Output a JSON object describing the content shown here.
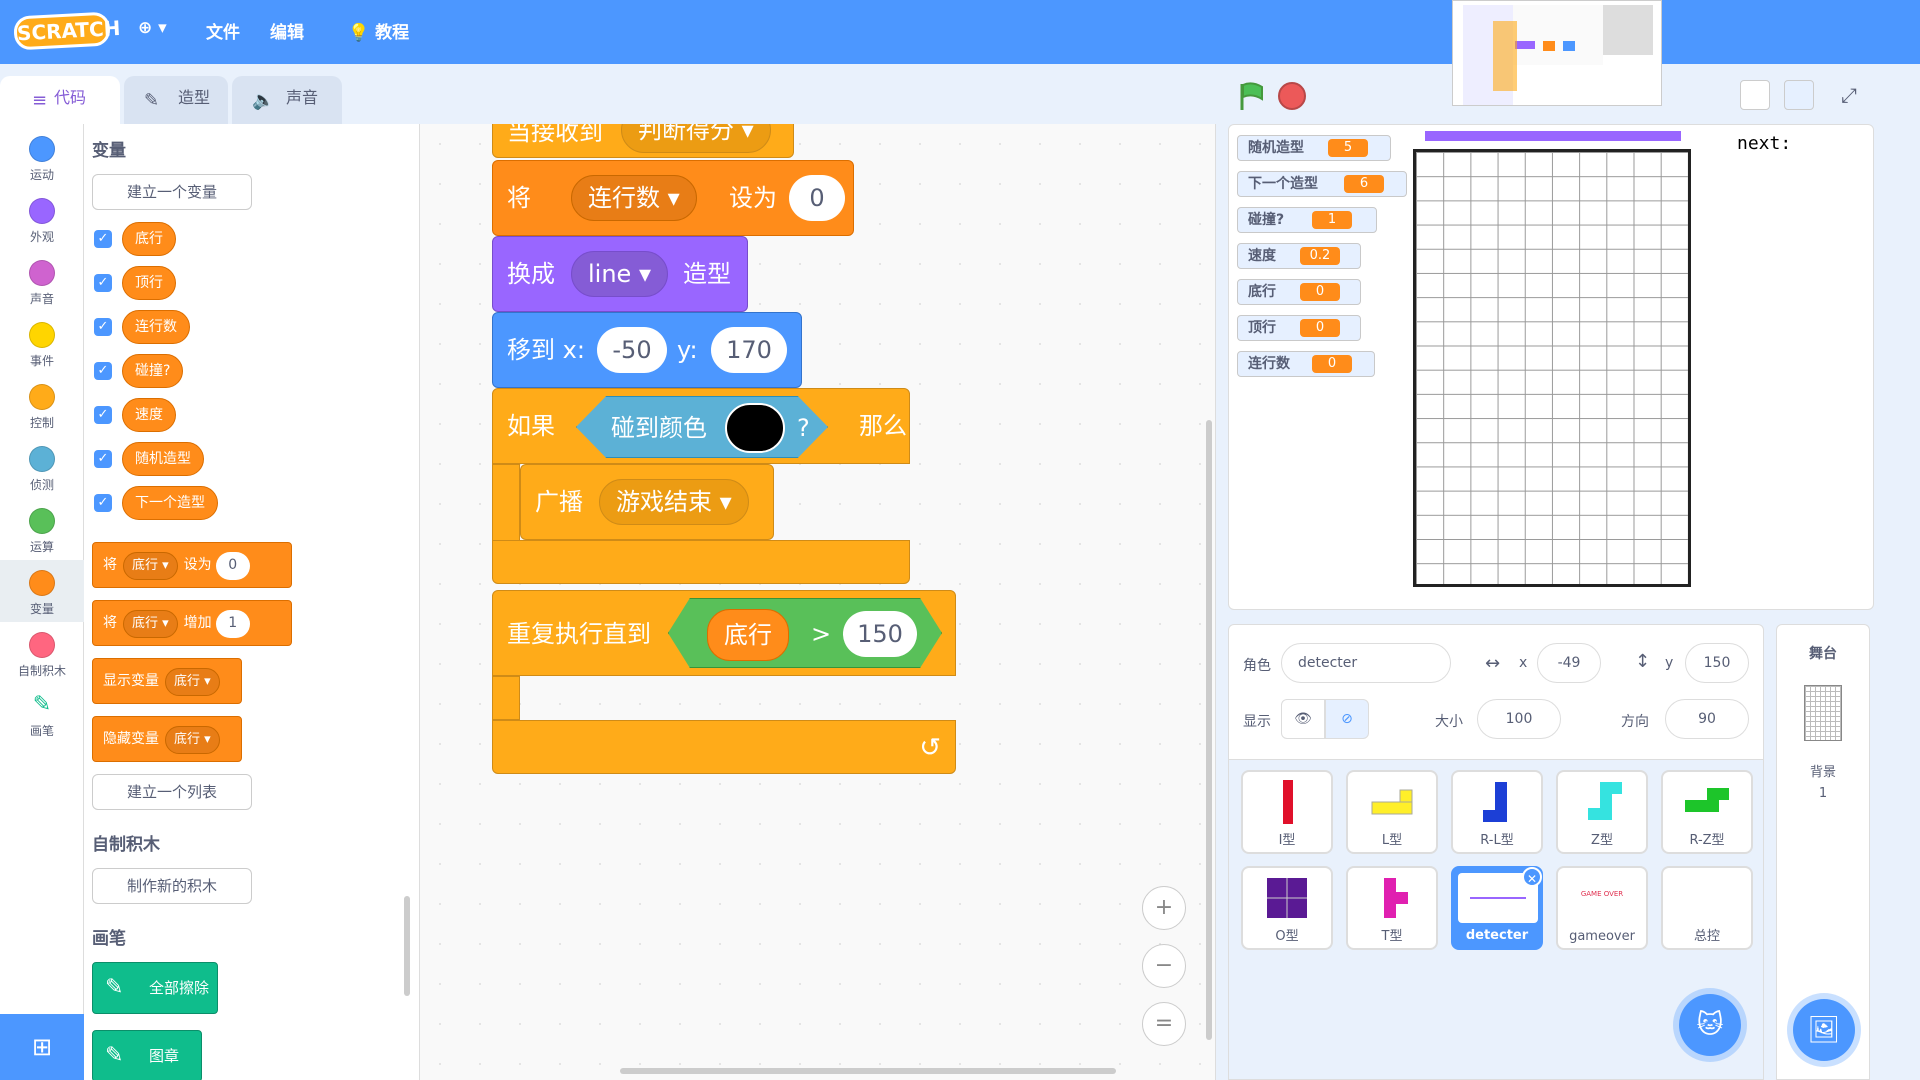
{
  "menubar": {
    "logo": "SCRATCH",
    "globe": "⊕ ▾",
    "file": "文件",
    "edit": "编辑",
    "tutorial": "教程"
  },
  "tabs": {
    "code": "代码",
    "costumes": "造型",
    "sounds": "声音"
  },
  "categories": [
    {
      "label": "运动",
      "color": "#4c97ff"
    },
    {
      "label": "外观",
      "color": "#9966ff"
    },
    {
      "label": "声音",
      "color": "#cf63cf"
    },
    {
      "label": "事件",
      "color": "#ffd500"
    },
    {
      "label": "控制",
      "color": "#ffab19"
    },
    {
      "label": "侦测",
      "color": "#5cb1d6"
    },
    {
      "label": "运算",
      "color": "#59c059"
    },
    {
      "label": "变量",
      "color": "#ff8c1a"
    },
    {
      "label": "自制积木",
      "color": "#ff6680"
    },
    {
      "label": "画笔",
      "color": "#0fbd8c"
    }
  ],
  "palette": {
    "variables_title": "变量",
    "make_var": "建立一个变量",
    "vars": [
      "底行",
      "顶行",
      "连行数",
      "碰撞?",
      "速度",
      "随机造型",
      "下一个造型"
    ],
    "set_block": {
      "kw1": "将",
      "var": "底行 ▾",
      "kw2": "设为",
      "val": "0"
    },
    "change_block": {
      "kw1": "将",
      "var": "底行 ▾",
      "kw2": "增加",
      "val": "1"
    },
    "show_block": {
      "kw": "显示变量",
      "var": "底行 ▾"
    },
    "hide_block": {
      "kw": "隐藏变量",
      "var": "底行 ▾"
    },
    "make_list": "建立一个列表",
    "myblocks_title": "自制积木",
    "make_block": "制作新的积木",
    "pen_title": "画笔",
    "pen_clear": "全部擦除",
    "pen_stamp": "图章"
  },
  "script": {
    "hat_text": "当接收到",
    "hat_dd": "判断得分 ▾",
    "set_kw": "将",
    "set_var": "连行数 ▾",
    "set_kw2": "设为",
    "set_val": "0",
    "switch_kw": "换成",
    "switch_dd": "line ▾",
    "switch_kw2": "造型",
    "goto_kw": "移到 x:",
    "goto_x": "-50",
    "goto_ykw": "y:",
    "goto_y": "170",
    "if_kw": "如果",
    "touch_kw": "碰到颜色",
    "touch_q": "?",
    "then_kw": "那么",
    "broadcast_kw": "广播",
    "broadcast_dd": "游戏结束 ▾",
    "repeat_kw": "重复执行直到",
    "cond_var": "底行",
    "cond_op": ">",
    "cond_val": "150",
    "loop_arrow": "↺"
  },
  "zoom": {
    "in": "+",
    "out": "−",
    "reset": "="
  },
  "monitors": [
    {
      "name": "随机造型",
      "value": "5"
    },
    {
      "name": "下一个造型",
      "value": "6"
    },
    {
      "name": "碰撞?",
      "value": "1"
    },
    {
      "name": "速度",
      "value": "0.2"
    },
    {
      "name": "底行",
      "value": "0"
    },
    {
      "name": "顶行",
      "value": "0"
    },
    {
      "name": "连行数",
      "value": "0"
    }
  ],
  "stage": {
    "next_label": "next:"
  },
  "sprite_info": {
    "sprite_label": "角色",
    "sprite_name": "detecter",
    "x_label": "x",
    "x": "-49",
    "y_label": "y",
    "y": "150",
    "show_label": "显示",
    "size_label": "大小",
    "size": "100",
    "dir_label": "方向",
    "dir": "90"
  },
  "sprites": [
    {
      "name": "I型"
    },
    {
      "name": "L型"
    },
    {
      "name": "R-L型"
    },
    {
      "name": "Z型"
    },
    {
      "name": "R-Z型"
    },
    {
      "name": "O型"
    },
    {
      "name": "T型"
    },
    {
      "name": "detecter"
    },
    {
      "name": "gameover"
    },
    {
      "name": "总控"
    }
  ],
  "gameover_thumb_text": "GAME OVER",
  "stage_panel": {
    "title": "舞台",
    "bg_label": "背景",
    "bg_count": "1"
  },
  "colors": {
    "accent": "#4c97ff",
    "variables": "#ff8c1a",
    "events": "#ffab19",
    "looks": "#9966ff",
    "motion": "#4c97ff",
    "sensing": "#5cb1d6",
    "operators": "#59c059",
    "pen": "#0fbd8c"
  }
}
